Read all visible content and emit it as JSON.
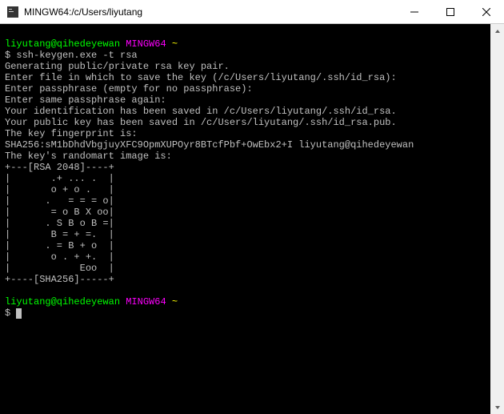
{
  "window": {
    "title": "MINGW64:/c/Users/liyutang"
  },
  "prompt1": {
    "user": "liyutang@qihedeyewan",
    "env": "MINGW64",
    "path": "~",
    "symbol": "$"
  },
  "command": "ssh-keygen.exe -t rsa",
  "output": {
    "l1": "Generating public/private rsa key pair.",
    "l2": "Enter file in which to save the key (/c/Users/liyutang/.ssh/id_rsa):",
    "l3": "Enter passphrase (empty for no passphrase):",
    "l4": "Enter same passphrase again:",
    "l5": "Your identification has been saved in /c/Users/liyutang/.ssh/id_rsa.",
    "l6": "Your public key has been saved in /c/Users/liyutang/.ssh/id_rsa.pub.",
    "l7": "The key fingerprint is:",
    "l8": "SHA256:sM1bDhdVbgjuyXFC9OpmXUPOyr8BTcfPbf+OwEbx2+I liyutang@qihedeyewan",
    "l9": "The key's randomart image is:",
    "r0": "+---[RSA 2048]----+",
    "r1": "|       .+ ... .  |",
    "r2": "|       o + o .   |",
    "r3": "|      .   = = = o|",
    "r4": "|       = o B X oo|",
    "r5": "|      . S B o B =|",
    "r6": "|       B = + =.  |",
    "r7": "|      . = B + o  |",
    "r8": "|       o . + +.  |",
    "r9": "|            Eoo  |",
    "r10": "+----[SHA256]-----+"
  },
  "prompt2": {
    "user": "liyutang@qihedeyewan",
    "env": "MINGW64",
    "path": "~",
    "symbol": "$"
  }
}
